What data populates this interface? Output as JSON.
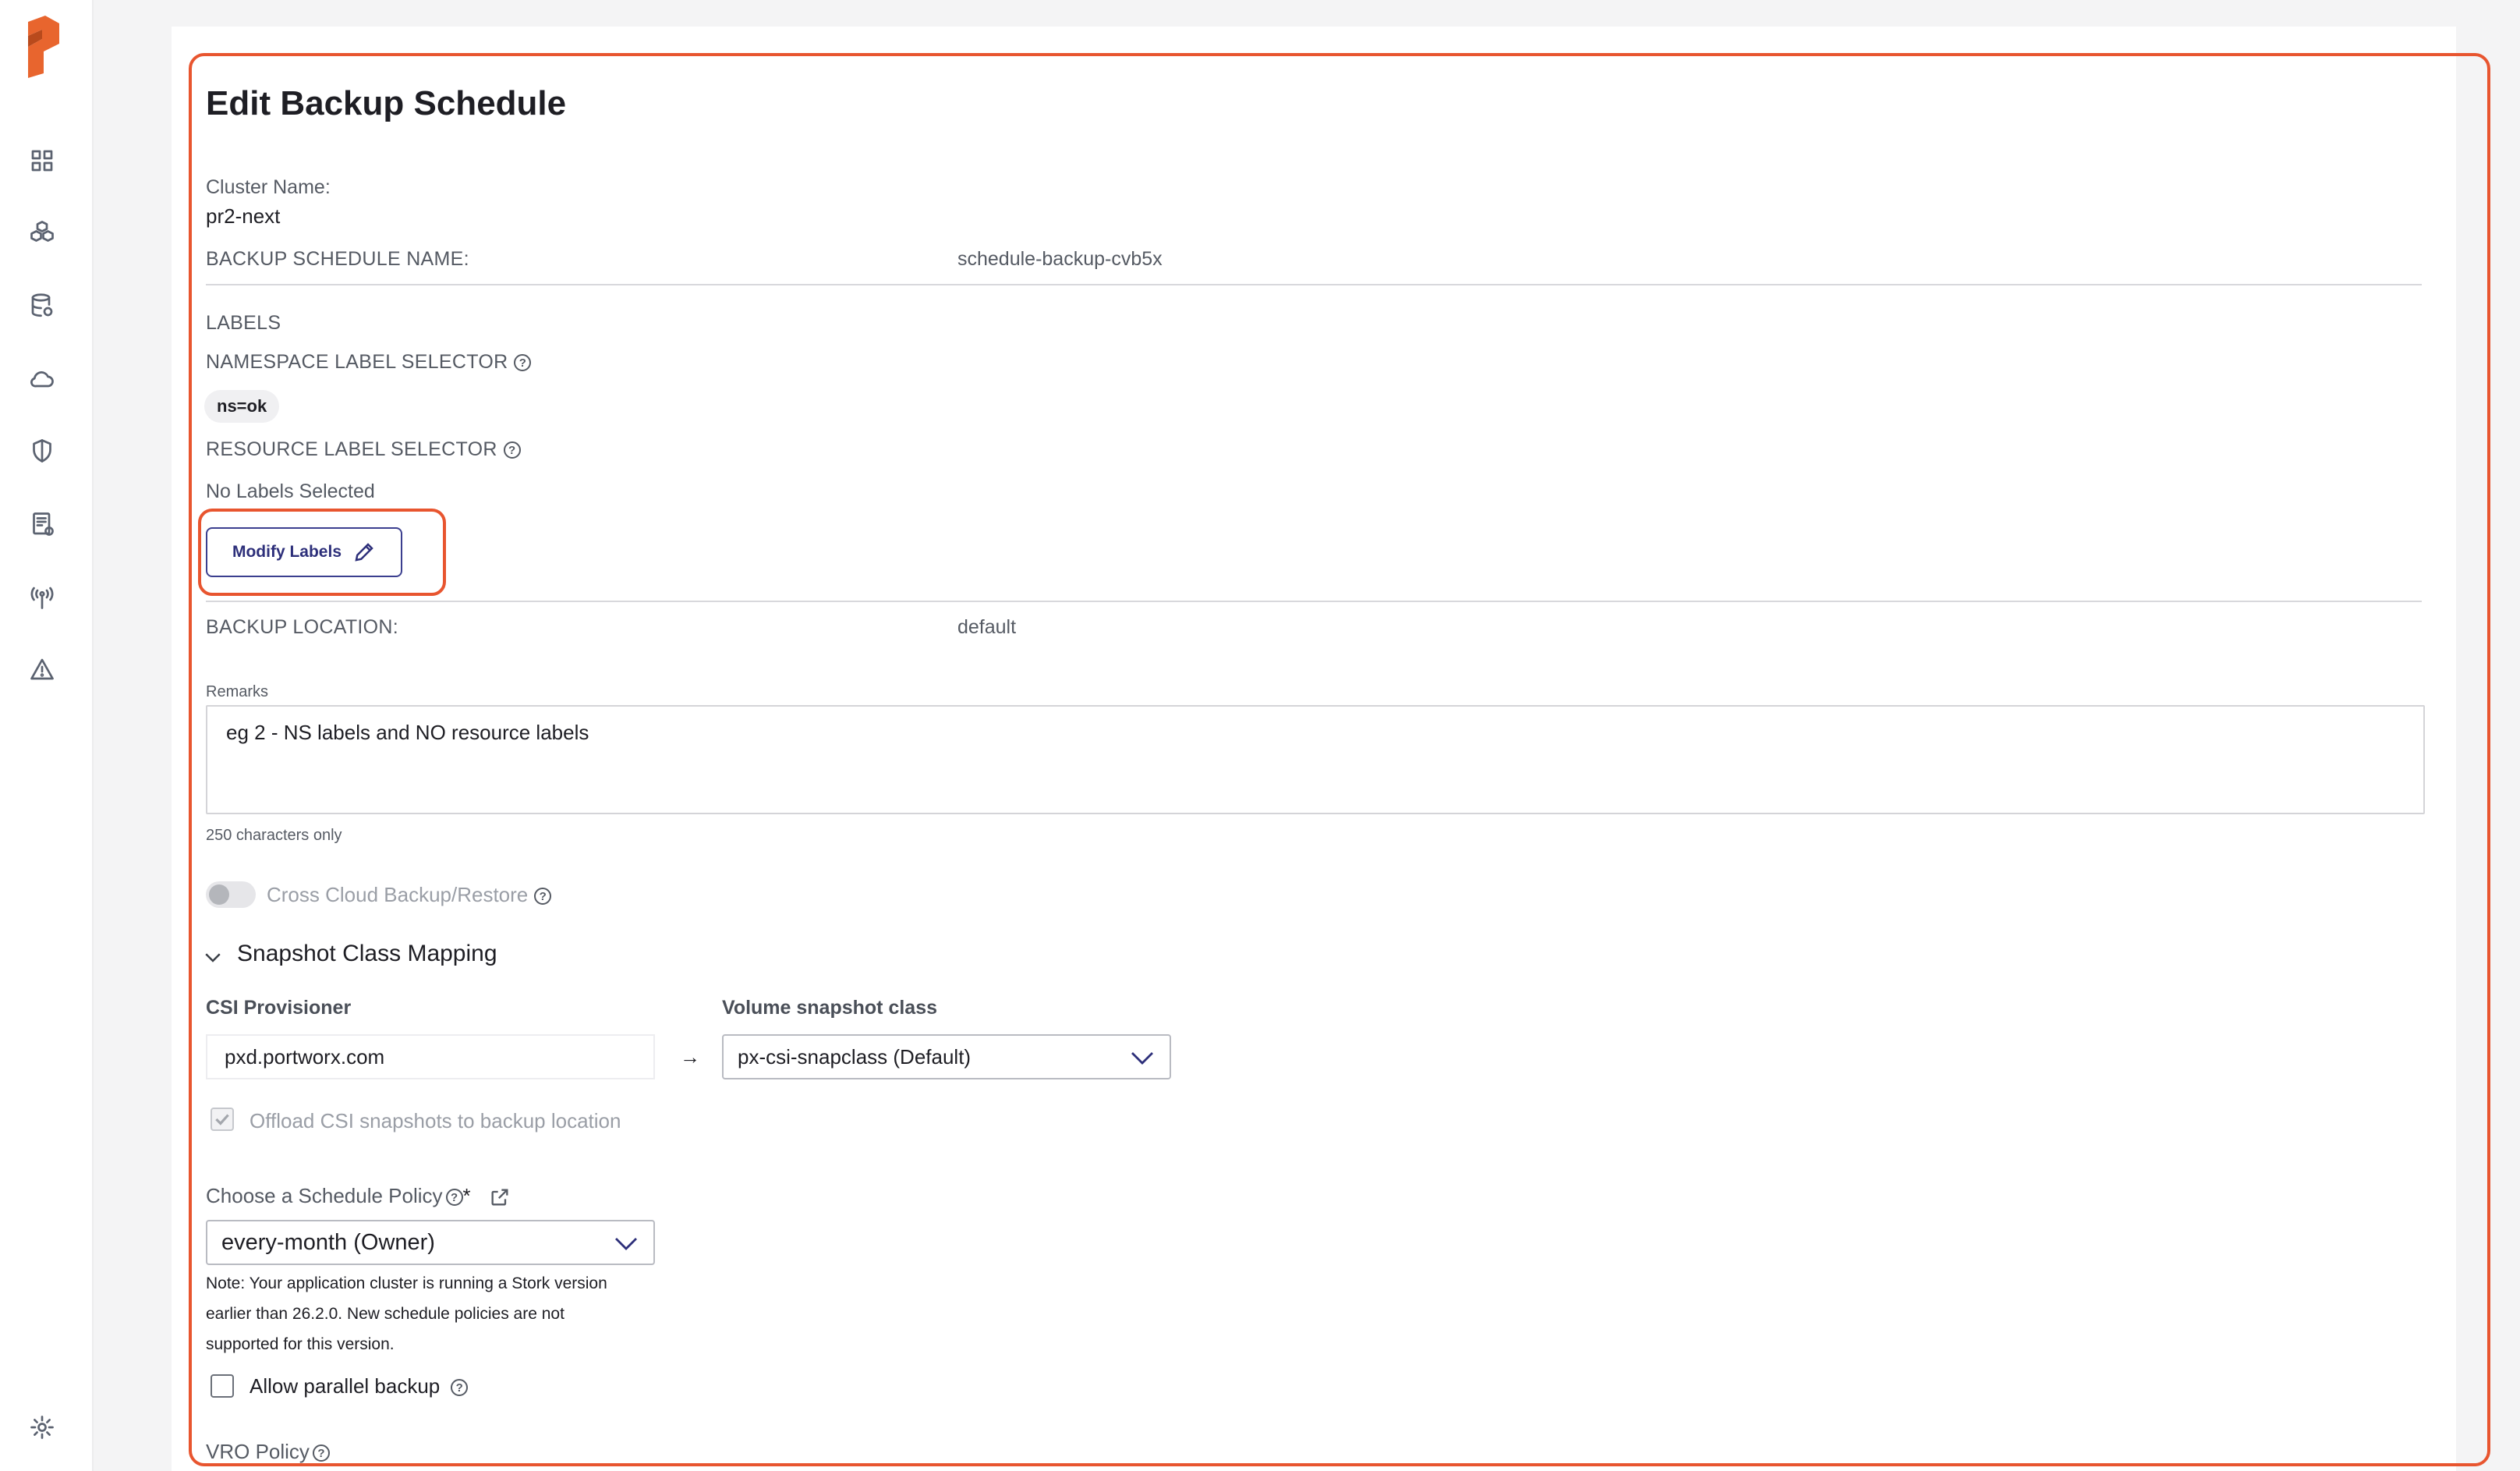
{
  "page": {
    "title": "Edit Backup Schedule"
  },
  "cluster": {
    "label": "Cluster Name:",
    "value": "pr2-next"
  },
  "schedule_name": {
    "label": "BACKUP SCHEDULE NAME:",
    "value": "schedule-backup-cvb5x"
  },
  "labels": {
    "heading": "LABELS",
    "namespace_selector_label": "NAMESPACE LABEL SELECTOR",
    "namespace_chip": "ns=ok",
    "resource_selector_label": "RESOURCE LABEL SELECTOR",
    "resource_empty": "No Labels Selected",
    "modify_button": "Modify Labels"
  },
  "backup_location": {
    "label": "BACKUP LOCATION:",
    "value": "default"
  },
  "remarks": {
    "label": "Remarks",
    "value": "eg 2 - NS labels and NO resource labels",
    "hint": "250 characters only"
  },
  "cross_cloud": {
    "label": "Cross Cloud Backup/Restore",
    "enabled": false
  },
  "snapshot_mapping": {
    "title": "Snapshot Class Mapping",
    "csi_label": "CSI Provisioner",
    "csi_value": "pxd.portworx.com",
    "arrow": "→",
    "volume_label": "Volume snapshot class",
    "volume_value": "px-csi-snapclass (Default)",
    "offload_label": "Offload CSI snapshots to backup location",
    "offload_checked": true
  },
  "schedule_policy": {
    "label": "Choose a Schedule Policy",
    "required_mark": "*",
    "value": "every-month (Owner)",
    "note_line1": "Note: Your application cluster is running a Stork version",
    "note_line2": "earlier than 26.2.0. New schedule policies are not",
    "note_line3": "supported for this version."
  },
  "parallel_backup": {
    "label": "Allow parallel backup",
    "checked": false
  },
  "vro": {
    "label": "VRO Policy"
  },
  "help_glyph": "?",
  "colors": {
    "highlight": "#e8552f",
    "brand": "#e8652e",
    "accent": "#2d2f7a"
  }
}
